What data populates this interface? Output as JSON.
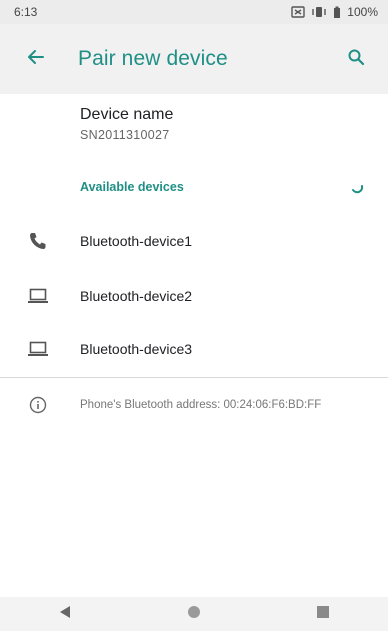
{
  "status_bar": {
    "time": "6:13",
    "battery_percent": "100%",
    "icons": [
      "nfc-icon",
      "vibrate-icon",
      "battery-icon"
    ]
  },
  "app_bar": {
    "title": "Pair new device",
    "back_icon": "arrow-back-icon",
    "search_icon": "search-icon",
    "accent_color": "#1f8f86"
  },
  "device_name": {
    "title": "Device name",
    "value": "SN2011310027"
  },
  "available_devices": {
    "header": "Available devices",
    "devices": [
      {
        "label": "Bluetooth-device1",
        "icon": "phone-icon"
      },
      {
        "label": "Bluetooth-device2",
        "icon": "laptop-icon"
      },
      {
        "label": "Bluetooth-device3",
        "icon": "laptop-icon"
      }
    ]
  },
  "info": {
    "text": "Phone's Bluetooth address: 00:24:06:F6:BD:FF",
    "icon": "info-icon"
  },
  "nav_bar": {
    "icons": [
      "back-triangle-icon",
      "home-circle-icon",
      "recents-square-icon"
    ]
  }
}
